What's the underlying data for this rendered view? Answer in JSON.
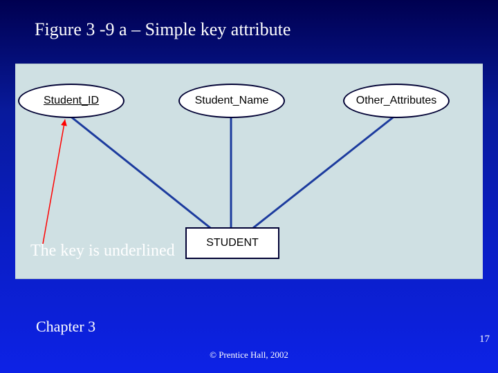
{
  "title": "Figure 3 -9 a – Simple key attribute",
  "diagram": {
    "attributes": [
      {
        "label": "Student_ID",
        "is_key": true
      },
      {
        "label": "Student_Name",
        "is_key": false
      },
      {
        "label": "Other_Attributes",
        "is_key": false
      }
    ],
    "entity": "STUDENT"
  },
  "annotation": "The key is underlined",
  "footer": {
    "chapter": "Chapter 3",
    "copyright": "© Prentice Hall, 2002",
    "page": "17"
  },
  "colors": {
    "slide_bg_top": "#000050",
    "slide_bg_bottom": "#0d22e6",
    "diagram_bg": "#cfe0e3",
    "connector": "#1c3b9e",
    "callout_arrow": "#ff0000"
  }
}
